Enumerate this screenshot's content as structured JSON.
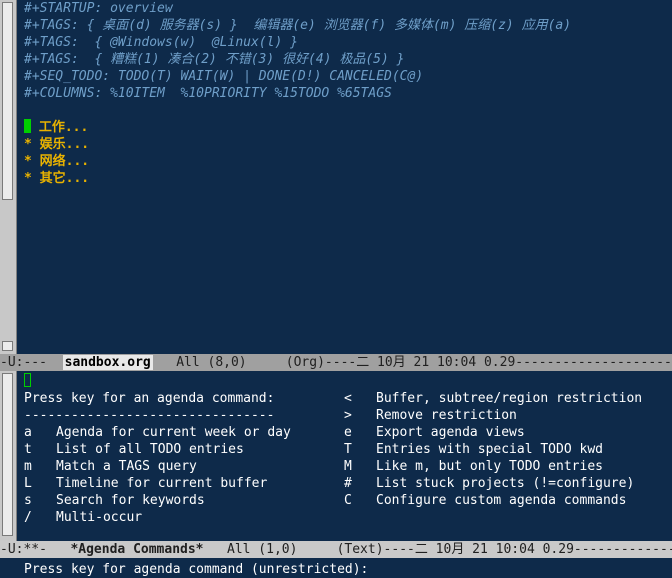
{
  "top_buffer": {
    "lines": [
      "#+STARTUP: overview",
      "#+TAGS: { 桌面(d) 服务器(s) }  编辑器(e) 浏览器(f) 多媒体(m) 压缩(z) 应用(a)",
      "#+TAGS:  { @Windows(w)  @Linux(l) }",
      "#+TAGS:  { 糟糕(1) 凑合(2) 不错(3) 很好(4) 极品(5) }",
      "#+SEQ_TODO: TODO(T) WAIT(W) | DONE(D!) CANCELED(C@)",
      "#+COLUMNS: %10ITEM  %10PRIORITY %15TODO %65TAGS"
    ],
    "headings": [
      {
        "star": "*",
        "title": " 工作..."
      },
      {
        "star": "*",
        "title": " 娱乐..."
      },
      {
        "star": "*",
        "title": " 网络..."
      },
      {
        "star": "*",
        "title": " 其它..."
      }
    ]
  },
  "top_modeline": {
    "prefix": "-U:---  ",
    "buffer_name": "sandbox.org",
    "position": "   All (8,0)     ",
    "mode": "(Org)----二 10月 21 10:04 0.29-----------------------"
  },
  "agenda": {
    "prompt": "Press key for an agenda command:",
    "separator": "--------------------------------",
    "left_items": [
      {
        "key": "a",
        "label": "Agenda for current week or day"
      },
      {
        "key": "t",
        "label": "List of all TODO entries"
      },
      {
        "key": "m",
        "label": "Match a TAGS query"
      },
      {
        "key": "L",
        "label": "Timeline for current buffer"
      },
      {
        "key": "s",
        "label": "Search for keywords"
      },
      {
        "key": "/",
        "label": "Multi-occur"
      }
    ],
    "right_items": [
      {
        "key": "<",
        "label": "Buffer, subtree/region restriction"
      },
      {
        "key": ">",
        "label": "Remove restriction"
      },
      {
        "key": "e",
        "label": "Export agenda views"
      },
      {
        "key": "T",
        "label": "Entries with special TODO kwd"
      },
      {
        "key": "M",
        "label": "Like m, but only TODO entries"
      },
      {
        "key": "#",
        "label": "List stuck projects (!=configure)"
      },
      {
        "key": "C",
        "label": "Configure custom agenda commands"
      }
    ]
  },
  "bottom_modeline": {
    "prefix": "-U:**-   ",
    "buffer_name": "*Agenda Commands*",
    "position": "   All (1,0)     ",
    "mode": "(Text)----二 10月 21 10:04 0.29--------------"
  },
  "minibuffer": {
    "text": "Press key for agenda command (unrestricted):"
  },
  "colors": {
    "background": "#0e2a4a",
    "meta_text": "#6f9fc9",
    "heading": "#e8b200",
    "cursor": "#00d000"
  }
}
